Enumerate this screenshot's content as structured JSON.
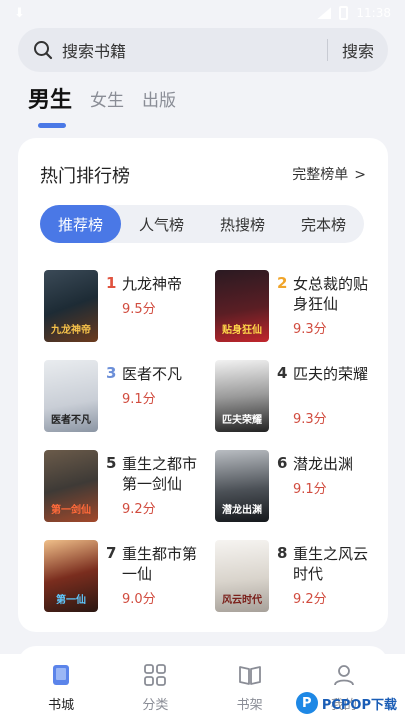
{
  "status_bar": {
    "time": "11:38"
  },
  "search": {
    "placeholder": "搜索书籍",
    "button_label": "搜索"
  },
  "top_tabs": [
    {
      "label": "男生",
      "active": true
    },
    {
      "label": "女生",
      "active": false
    },
    {
      "label": "出版",
      "active": false
    }
  ],
  "ranking": {
    "title": "热门排行榜",
    "full_list_label": "完整榜单",
    "tabs": [
      {
        "label": "推荐榜",
        "active": true
      },
      {
        "label": "人气榜",
        "active": false
      },
      {
        "label": "热搜榜",
        "active": false
      },
      {
        "label": "完本榜",
        "active": false
      }
    ],
    "books": [
      {
        "rank": "1",
        "title": "九龙神帝",
        "score": "9.5分",
        "cover_text": "九龙神帝",
        "rank_color": "#e0533f"
      },
      {
        "rank": "2",
        "title": "女总裁的贴身狂仙",
        "score": "9.3分",
        "cover_text": "贴身狂仙",
        "rank_color": "#f0a52b"
      },
      {
        "rank": "3",
        "title": "医者不凡",
        "score": "9.1分",
        "cover_text": "医者不凡",
        "rank_color": "#6c8fd8"
      },
      {
        "rank": "4",
        "title": "匹夫的荣耀",
        "score": "9.3分",
        "cover_text": "匹夫荣耀",
        "rank_color": "#333333"
      },
      {
        "rank": "5",
        "title": "重生之都市第一剑仙",
        "score": "9.2分",
        "cover_text": "第一剑仙",
        "rank_color": "#333333"
      },
      {
        "rank": "6",
        "title": "潜龙出渊",
        "score": "9.1分",
        "cover_text": "潜龙出渊",
        "rank_color": "#333333"
      },
      {
        "rank": "7",
        "title": "重生都市第一仙",
        "score": "9.0分",
        "cover_text": "第一仙",
        "rank_color": "#333333"
      },
      {
        "rank": "8",
        "title": "重生之风云时代",
        "score": "9.2分",
        "cover_text": "风云时代",
        "rank_color": "#333333"
      }
    ]
  },
  "bottom_nav": [
    {
      "label": "书城",
      "icon": "phone-book-icon",
      "active": true
    },
    {
      "label": "分类",
      "icon": "grid-icon",
      "active": false
    },
    {
      "label": "书架",
      "icon": "open-book-icon",
      "active": false
    },
    {
      "label": "我的",
      "icon": "user-icon",
      "active": false
    }
  ],
  "watermark": {
    "logo_letter": "P",
    "text": "PCPOP下载"
  },
  "colors": {
    "accent": "#4a78e6",
    "score": "#d14c3f",
    "background": "#f2f3f7"
  }
}
